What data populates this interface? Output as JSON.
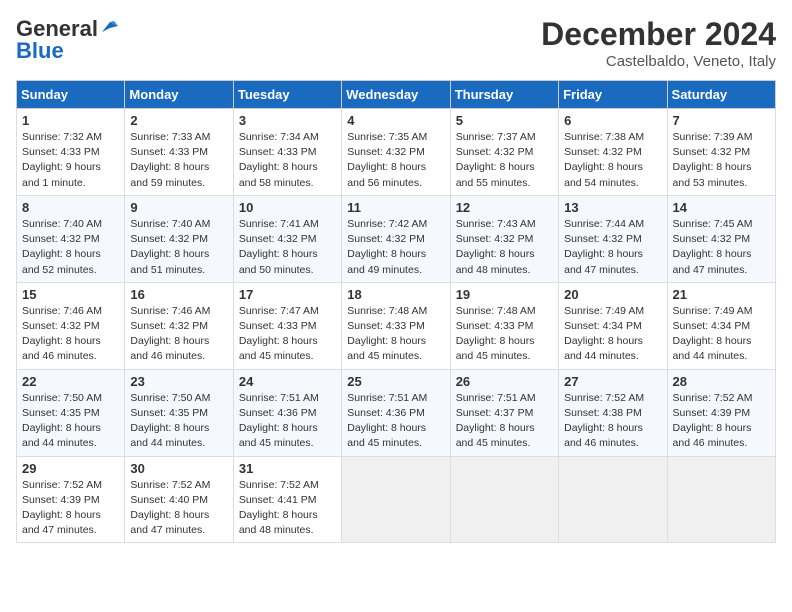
{
  "header": {
    "logo_general": "General",
    "logo_blue": "Blue",
    "month_title": "December 2024",
    "location": "Castelbaldo, Veneto, Italy"
  },
  "days_of_week": [
    "Sunday",
    "Monday",
    "Tuesday",
    "Wednesday",
    "Thursday",
    "Friday",
    "Saturday"
  ],
  "weeks": [
    [
      {
        "day": "1",
        "sunrise": "Sunrise: 7:32 AM",
        "sunset": "Sunset: 4:33 PM",
        "daylight": "Daylight: 9 hours and 1 minute."
      },
      {
        "day": "2",
        "sunrise": "Sunrise: 7:33 AM",
        "sunset": "Sunset: 4:33 PM",
        "daylight": "Daylight: 8 hours and 59 minutes."
      },
      {
        "day": "3",
        "sunrise": "Sunrise: 7:34 AM",
        "sunset": "Sunset: 4:33 PM",
        "daylight": "Daylight: 8 hours and 58 minutes."
      },
      {
        "day": "4",
        "sunrise": "Sunrise: 7:35 AM",
        "sunset": "Sunset: 4:32 PM",
        "daylight": "Daylight: 8 hours and 56 minutes."
      },
      {
        "day": "5",
        "sunrise": "Sunrise: 7:37 AM",
        "sunset": "Sunset: 4:32 PM",
        "daylight": "Daylight: 8 hours and 55 minutes."
      },
      {
        "day": "6",
        "sunrise": "Sunrise: 7:38 AM",
        "sunset": "Sunset: 4:32 PM",
        "daylight": "Daylight: 8 hours and 54 minutes."
      },
      {
        "day": "7",
        "sunrise": "Sunrise: 7:39 AM",
        "sunset": "Sunset: 4:32 PM",
        "daylight": "Daylight: 8 hours and 53 minutes."
      }
    ],
    [
      {
        "day": "8",
        "sunrise": "Sunrise: 7:40 AM",
        "sunset": "Sunset: 4:32 PM",
        "daylight": "Daylight: 8 hours and 52 minutes."
      },
      {
        "day": "9",
        "sunrise": "Sunrise: 7:40 AM",
        "sunset": "Sunset: 4:32 PM",
        "daylight": "Daylight: 8 hours and 51 minutes."
      },
      {
        "day": "10",
        "sunrise": "Sunrise: 7:41 AM",
        "sunset": "Sunset: 4:32 PM",
        "daylight": "Daylight: 8 hours and 50 minutes."
      },
      {
        "day": "11",
        "sunrise": "Sunrise: 7:42 AM",
        "sunset": "Sunset: 4:32 PM",
        "daylight": "Daylight: 8 hours and 49 minutes."
      },
      {
        "day": "12",
        "sunrise": "Sunrise: 7:43 AM",
        "sunset": "Sunset: 4:32 PM",
        "daylight": "Daylight: 8 hours and 48 minutes."
      },
      {
        "day": "13",
        "sunrise": "Sunrise: 7:44 AM",
        "sunset": "Sunset: 4:32 PM",
        "daylight": "Daylight: 8 hours and 47 minutes."
      },
      {
        "day": "14",
        "sunrise": "Sunrise: 7:45 AM",
        "sunset": "Sunset: 4:32 PM",
        "daylight": "Daylight: 8 hours and 47 minutes."
      }
    ],
    [
      {
        "day": "15",
        "sunrise": "Sunrise: 7:46 AM",
        "sunset": "Sunset: 4:32 PM",
        "daylight": "Daylight: 8 hours and 46 minutes."
      },
      {
        "day": "16",
        "sunrise": "Sunrise: 7:46 AM",
        "sunset": "Sunset: 4:32 PM",
        "daylight": "Daylight: 8 hours and 46 minutes."
      },
      {
        "day": "17",
        "sunrise": "Sunrise: 7:47 AM",
        "sunset": "Sunset: 4:33 PM",
        "daylight": "Daylight: 8 hours and 45 minutes."
      },
      {
        "day": "18",
        "sunrise": "Sunrise: 7:48 AM",
        "sunset": "Sunset: 4:33 PM",
        "daylight": "Daylight: 8 hours and 45 minutes."
      },
      {
        "day": "19",
        "sunrise": "Sunrise: 7:48 AM",
        "sunset": "Sunset: 4:33 PM",
        "daylight": "Daylight: 8 hours and 45 minutes."
      },
      {
        "day": "20",
        "sunrise": "Sunrise: 7:49 AM",
        "sunset": "Sunset: 4:34 PM",
        "daylight": "Daylight: 8 hours and 44 minutes."
      },
      {
        "day": "21",
        "sunrise": "Sunrise: 7:49 AM",
        "sunset": "Sunset: 4:34 PM",
        "daylight": "Daylight: 8 hours and 44 minutes."
      }
    ],
    [
      {
        "day": "22",
        "sunrise": "Sunrise: 7:50 AM",
        "sunset": "Sunset: 4:35 PM",
        "daylight": "Daylight: 8 hours and 44 minutes."
      },
      {
        "day": "23",
        "sunrise": "Sunrise: 7:50 AM",
        "sunset": "Sunset: 4:35 PM",
        "daylight": "Daylight: 8 hours and 44 minutes."
      },
      {
        "day": "24",
        "sunrise": "Sunrise: 7:51 AM",
        "sunset": "Sunset: 4:36 PM",
        "daylight": "Daylight: 8 hours and 45 minutes."
      },
      {
        "day": "25",
        "sunrise": "Sunrise: 7:51 AM",
        "sunset": "Sunset: 4:36 PM",
        "daylight": "Daylight: 8 hours and 45 minutes."
      },
      {
        "day": "26",
        "sunrise": "Sunrise: 7:51 AM",
        "sunset": "Sunset: 4:37 PM",
        "daylight": "Daylight: 8 hours and 45 minutes."
      },
      {
        "day": "27",
        "sunrise": "Sunrise: 7:52 AM",
        "sunset": "Sunset: 4:38 PM",
        "daylight": "Daylight: 8 hours and 46 minutes."
      },
      {
        "day": "28",
        "sunrise": "Sunrise: 7:52 AM",
        "sunset": "Sunset: 4:39 PM",
        "daylight": "Daylight: 8 hours and 46 minutes."
      }
    ],
    [
      {
        "day": "29",
        "sunrise": "Sunrise: 7:52 AM",
        "sunset": "Sunset: 4:39 PM",
        "daylight": "Daylight: 8 hours and 47 minutes."
      },
      {
        "day": "30",
        "sunrise": "Sunrise: 7:52 AM",
        "sunset": "Sunset: 4:40 PM",
        "daylight": "Daylight: 8 hours and 47 minutes."
      },
      {
        "day": "31",
        "sunrise": "Sunrise: 7:52 AM",
        "sunset": "Sunset: 4:41 PM",
        "daylight": "Daylight: 8 hours and 48 minutes."
      },
      null,
      null,
      null,
      null
    ]
  ]
}
